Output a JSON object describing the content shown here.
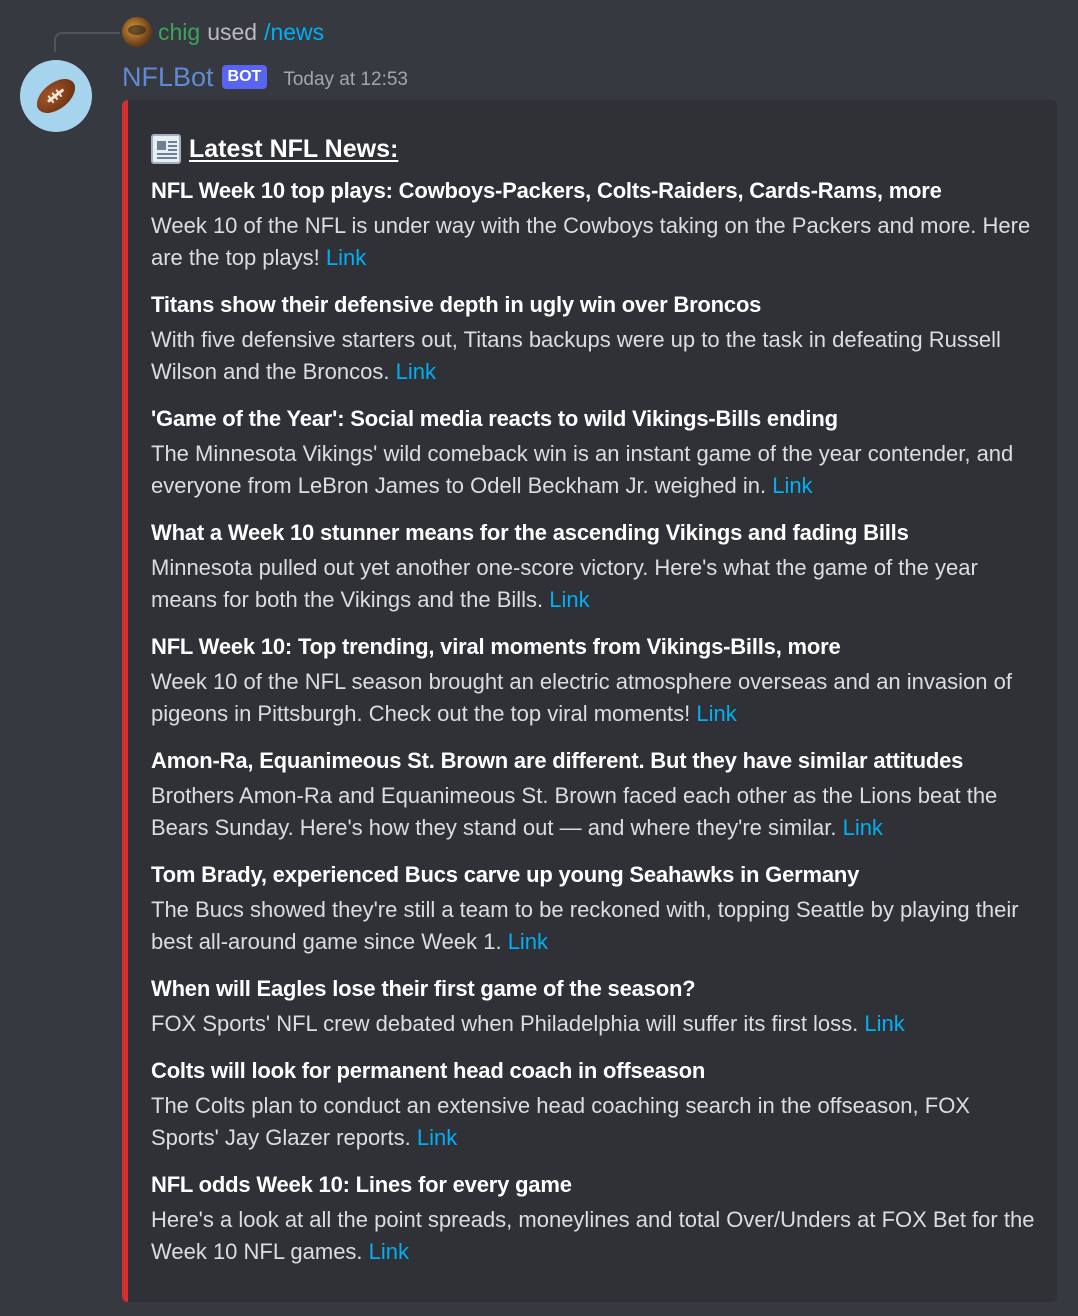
{
  "command": {
    "user": "chig",
    "action": "used",
    "name": "/news"
  },
  "message": {
    "author": "NFLBot",
    "badge": "BOT",
    "timestamp": "Today at 12:53",
    "avatar_icon": "football-icon"
  },
  "embed": {
    "accent_color": "#d32f2f",
    "title_icon": "newspaper-icon",
    "title": "Latest NFL News:",
    "link_label": "Link",
    "items": [
      {
        "title": "NFL Week 10 top plays: Cowboys-Packers, Colts-Raiders, Cards-Rams, more",
        "description": "Week 10 of the NFL is under way with the Cowboys taking on the Packers and more. Here are the top plays!",
        "link": "Link"
      },
      {
        "title": "Titans show their defensive depth in ugly win over Broncos",
        "description": "With five defensive starters out, Titans backups were up to the task in defeating Russell Wilson and the Broncos.",
        "link": "Link"
      },
      {
        "title": "'Game of the Year': Social media reacts to wild Vikings-Bills ending",
        "description": "The Minnesota Vikings' wild comeback win is an instant game of the year contender, and everyone from LeBron James to Odell Beckham Jr. weighed in.",
        "link": "Link"
      },
      {
        "title": "What a Week 10 stunner means for the ascending Vikings and fading Bills",
        "description": "Minnesota pulled out yet another one-score victory. Here's what the game of the year means for both the Vikings and the Bills.",
        "link": "Link"
      },
      {
        "title": "NFL Week 10: Top trending, viral moments from Vikings-Bills, more",
        "description": "Week 10 of the NFL season brought an electric atmosphere overseas and an invasion of pigeons in Pittsburgh. Check out the top viral moments!",
        "link": "Link"
      },
      {
        "title": "Amon-Ra, Equanimeous St. Brown are different. But they have similar attitudes",
        "description": "Brothers Amon-Ra and Equanimeous St. Brown faced each other as the Lions beat the Bears Sunday. Here's how they stand out — and where they're similar.",
        "link": "Link"
      },
      {
        "title": "Tom Brady, experienced Bucs carve up young Seahawks in Germany",
        "description": "The Bucs showed they're still a team to be reckoned with, topping Seattle by playing their best all-around game since Week 1.",
        "link": "Link"
      },
      {
        "title": "When will Eagles lose their first game of the season?",
        "description": "FOX Sports' NFL crew debated when Philadelphia will suffer its first loss.",
        "link": "Link"
      },
      {
        "title": "Colts will look for permanent head coach in offseason",
        "description": "The Colts plan to conduct an extensive head coaching search in the offseason, FOX Sports' Jay Glazer reports.",
        "link": "Link"
      },
      {
        "title": "NFL odds Week 10: Lines for every game",
        "description": "Here's a look at all the point spreads, moneylines and total Over/Unders at FOX Bet for the Week 10 NFL games.",
        "link": "Link"
      }
    ]
  }
}
